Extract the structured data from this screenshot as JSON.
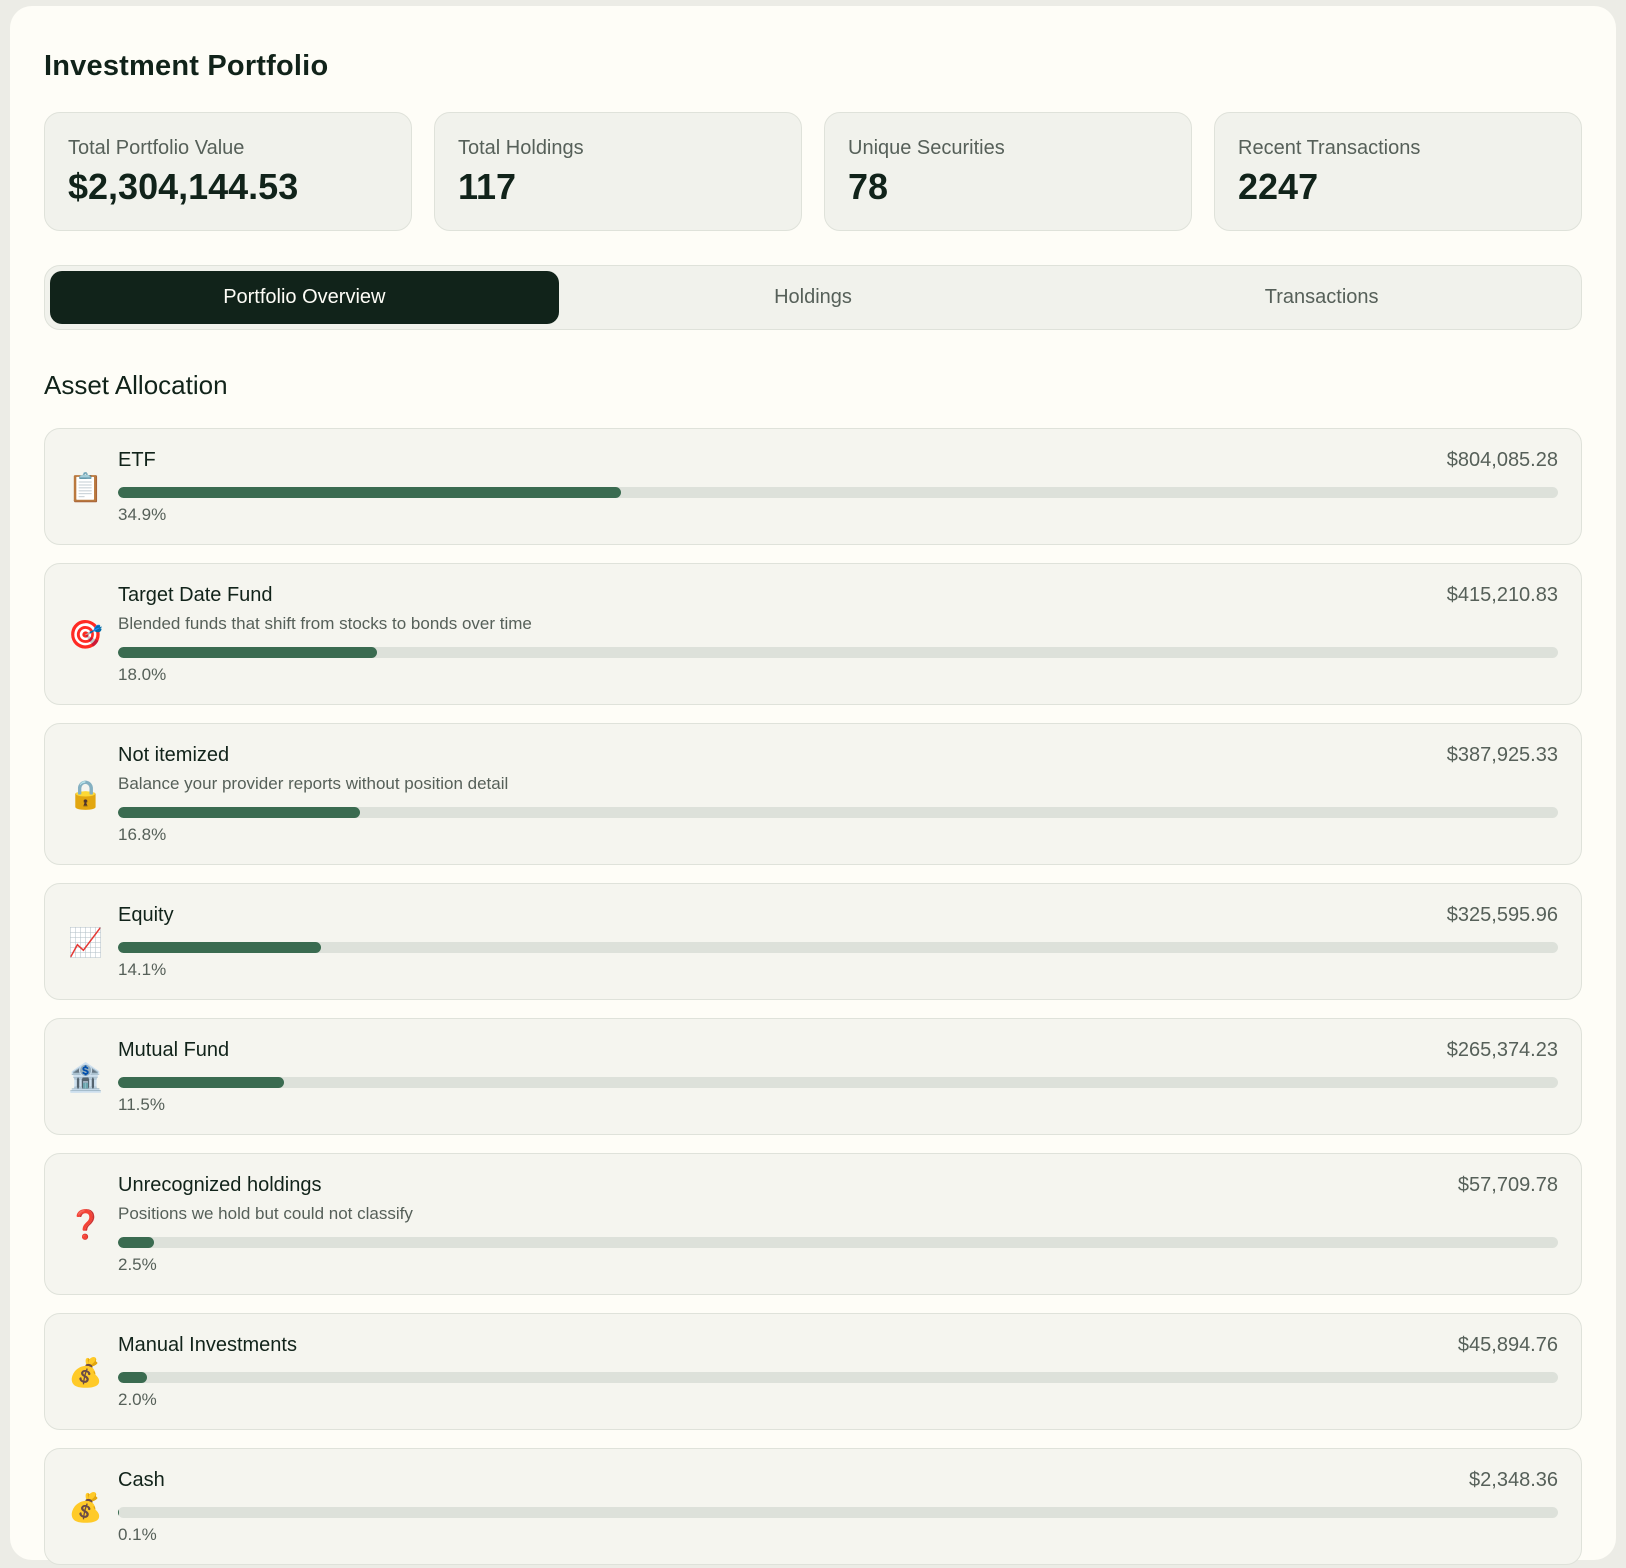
{
  "header": {
    "title": "Investment Portfolio"
  },
  "stats": [
    {
      "label": "Total Portfolio Value",
      "value": "$2,304,144.53"
    },
    {
      "label": "Total Holdings",
      "value": "117"
    },
    {
      "label": "Unique Securities",
      "value": "78"
    },
    {
      "label": "Recent Transactions",
      "value": "2247"
    }
  ],
  "tabs": [
    {
      "label": "Portfolio Overview",
      "active": true
    },
    {
      "label": "Holdings",
      "active": false
    },
    {
      "label": "Transactions",
      "active": false
    }
  ],
  "allocation": {
    "title": "Asset Allocation",
    "items": [
      {
        "icon": "clipboard-icon",
        "glyph": "📋",
        "name": "ETF",
        "amount": "$804,085.28",
        "description": "",
        "percent_label": "34.9%",
        "percent": 34.9
      },
      {
        "icon": "target-icon",
        "glyph": "🎯",
        "name": "Target Date Fund",
        "amount": "$415,210.83",
        "description": "Blended funds that shift from stocks to bonds over time",
        "percent_label": "18.0%",
        "percent": 18.0
      },
      {
        "icon": "lock-icon",
        "glyph": "🔒",
        "name": "Not itemized",
        "amount": "$387,925.33",
        "description": "Balance your provider reports without position detail",
        "percent_label": "16.8%",
        "percent": 16.8
      },
      {
        "icon": "chart-increasing-icon",
        "glyph": "📈",
        "name": "Equity",
        "amount": "$325,595.96",
        "description": "",
        "percent_label": "14.1%",
        "percent": 14.1
      },
      {
        "icon": "bank-icon",
        "glyph": "🏦",
        "name": "Mutual Fund",
        "amount": "$265,374.23",
        "description": "",
        "percent_label": "11.5%",
        "percent": 11.5
      },
      {
        "icon": "question-mark-icon",
        "glyph": "❓",
        "name": "Unrecognized holdings",
        "amount": "$57,709.78",
        "description": "Positions we hold but could not classify",
        "percent_label": "2.5%",
        "percent": 2.5
      },
      {
        "icon": "money-bag-icon",
        "glyph": "💰",
        "name": "Manual Investments",
        "amount": "$45,894.76",
        "description": "",
        "percent_label": "2.0%",
        "percent": 2.0
      },
      {
        "icon": "money-bag-icon",
        "glyph": "💰",
        "name": "Cash",
        "amount": "$2,348.36",
        "description": "",
        "percent_label": "0.1%",
        "percent": 0.1
      }
    ]
  }
}
